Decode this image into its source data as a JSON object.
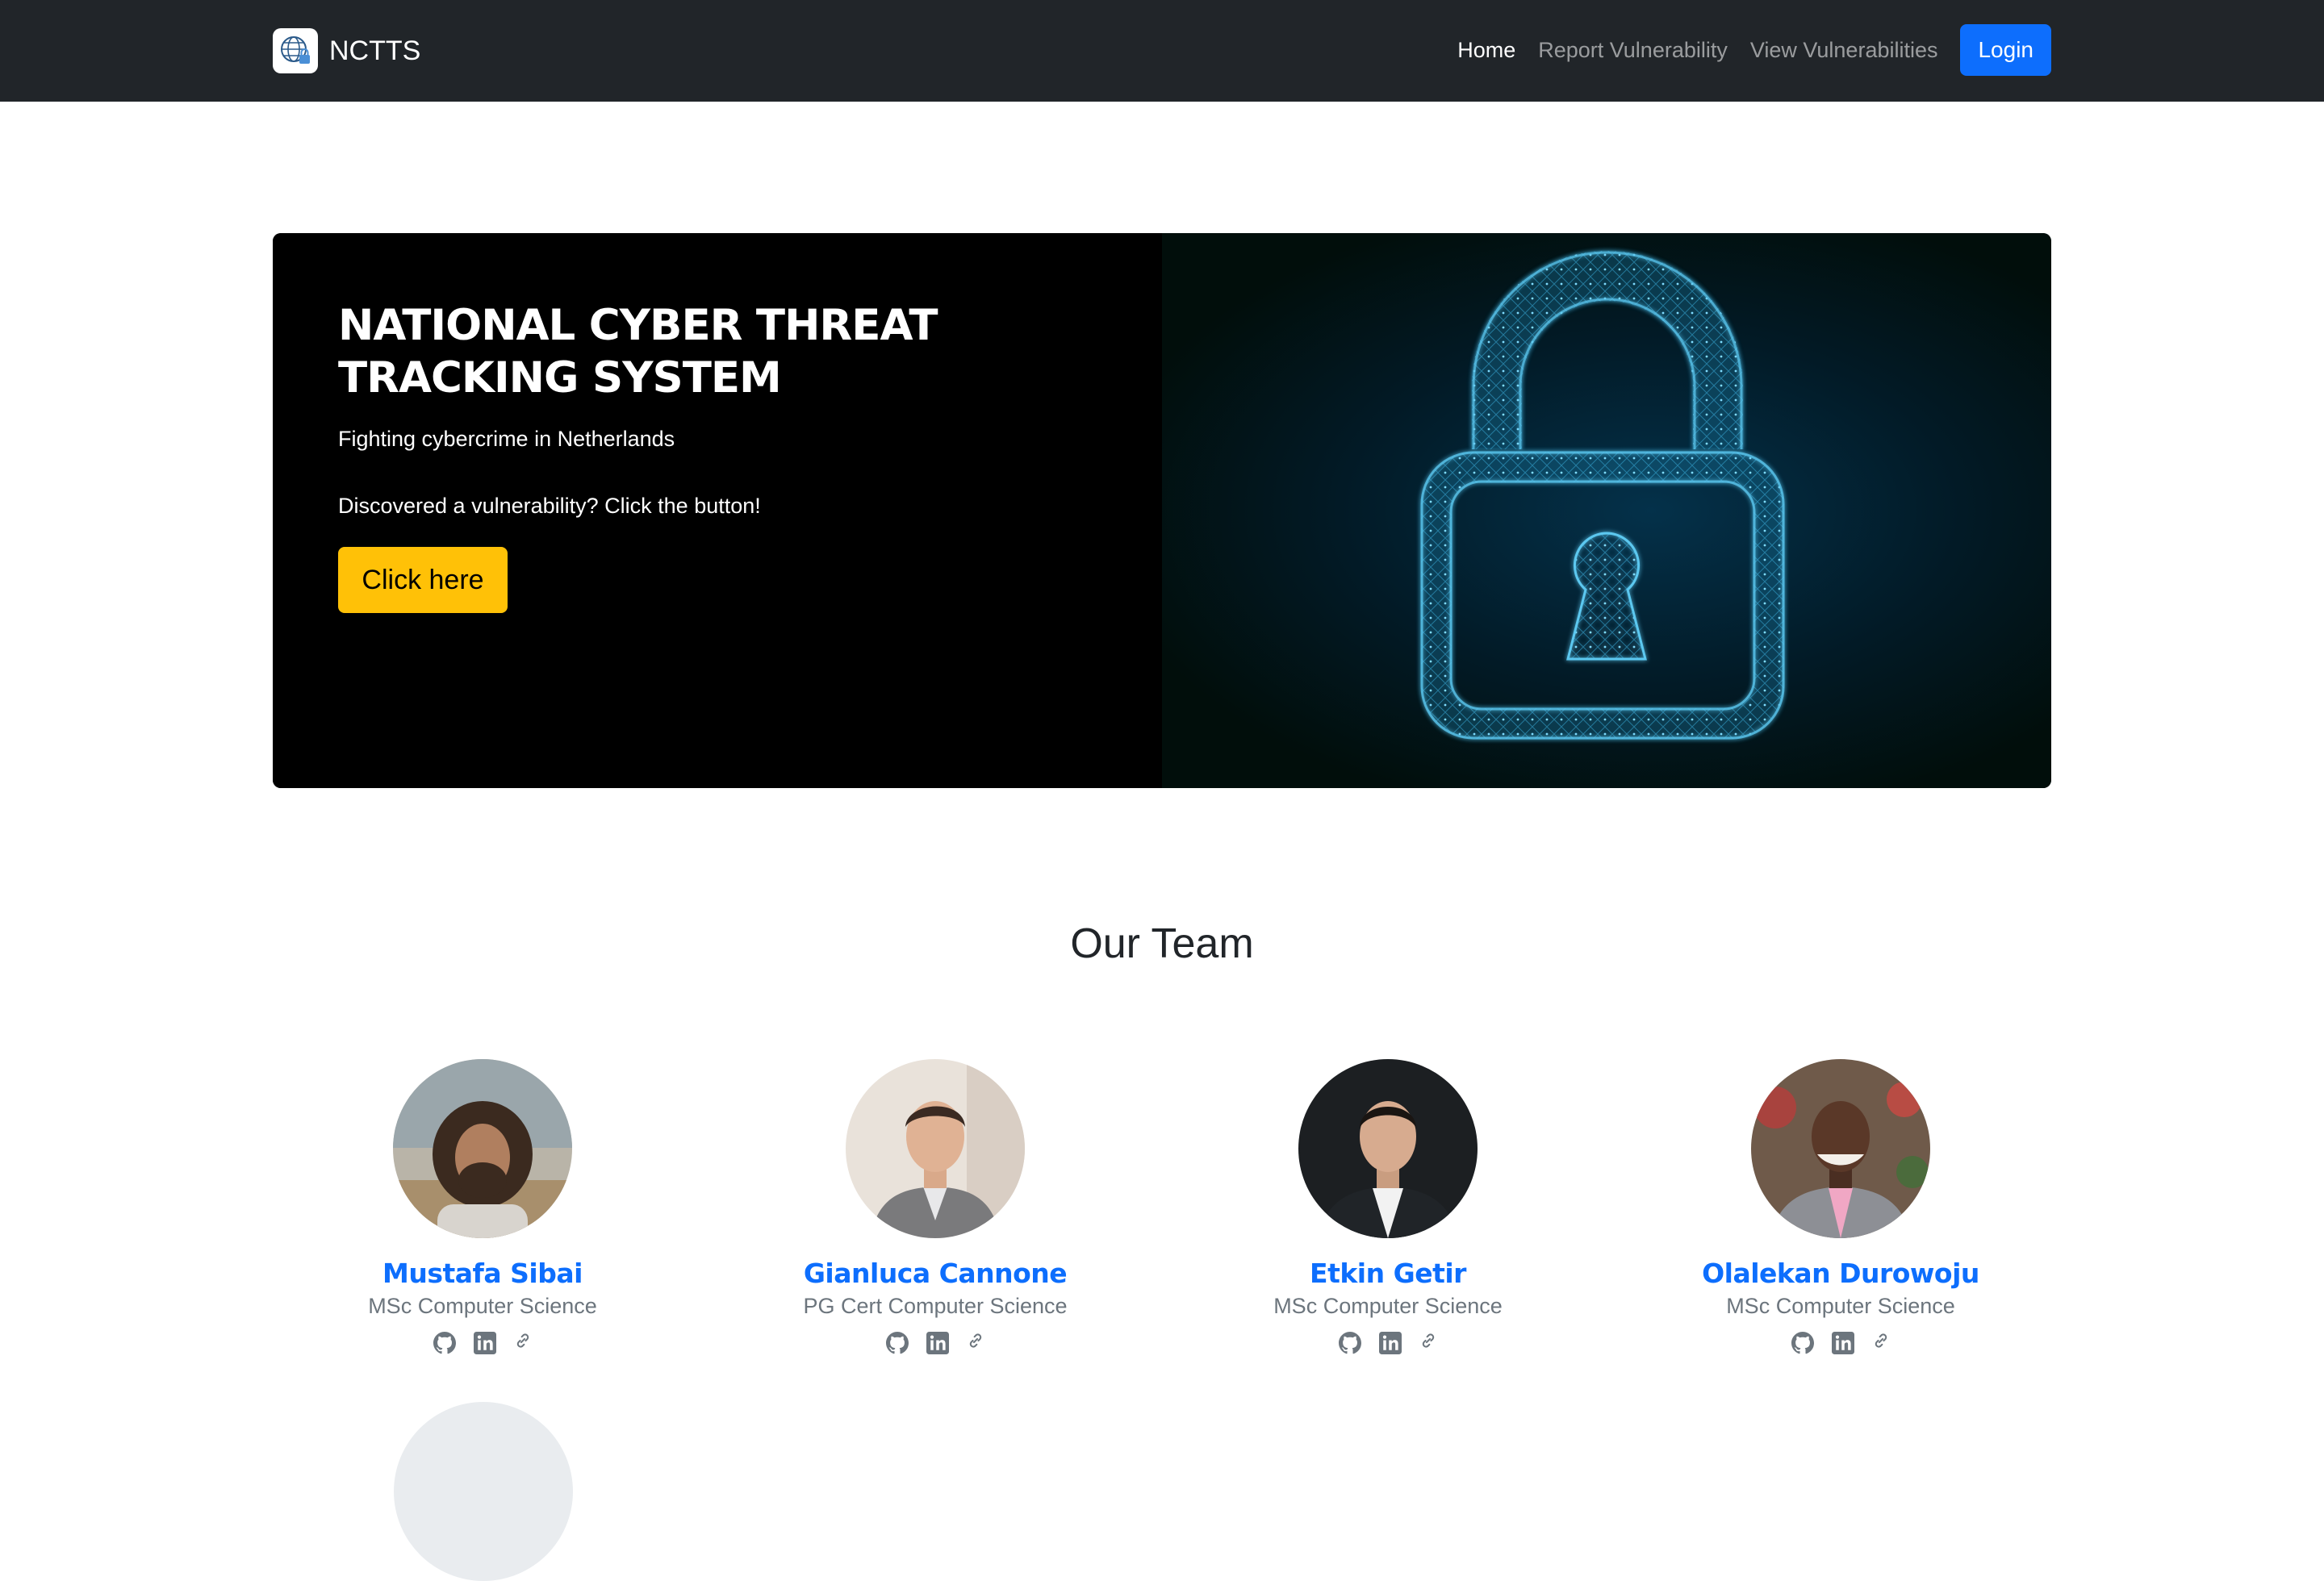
{
  "navbar": {
    "brand": "NCTTS",
    "links": [
      {
        "label": "Home",
        "active": true
      },
      {
        "label": "Report Vulnerability",
        "active": false
      },
      {
        "label": "View Vulnerabilities",
        "active": false
      }
    ],
    "login": "Login"
  },
  "hero": {
    "title": "NATIONAL CYBER THREAT TRACKING SYSTEM",
    "subtitle": "Fighting cybercrime in Netherlands",
    "prompt": "Discovered a vulnerability? Click the button!",
    "cta": "Click here",
    "image_icon": "padlock-icon"
  },
  "team": {
    "heading": "Our Team",
    "members": [
      {
        "name": "Mustafa Sibai",
        "role": "MSc Computer Science"
      },
      {
        "name": "Gianluca Cannone",
        "role": "PG Cert Computer Science"
      },
      {
        "name": "Etkin Getir",
        "role": "MSc Computer Science"
      },
      {
        "name": "Olalekan Durowoju",
        "role": "MSc Computer Science"
      }
    ],
    "social_icons": [
      "github-icon",
      "linkedin-icon",
      "link-icon"
    ]
  },
  "colors": {
    "navbar": "#212529",
    "primary": "#0d6efd",
    "cta": "#ffc107",
    "muted": "#6c757d"
  }
}
